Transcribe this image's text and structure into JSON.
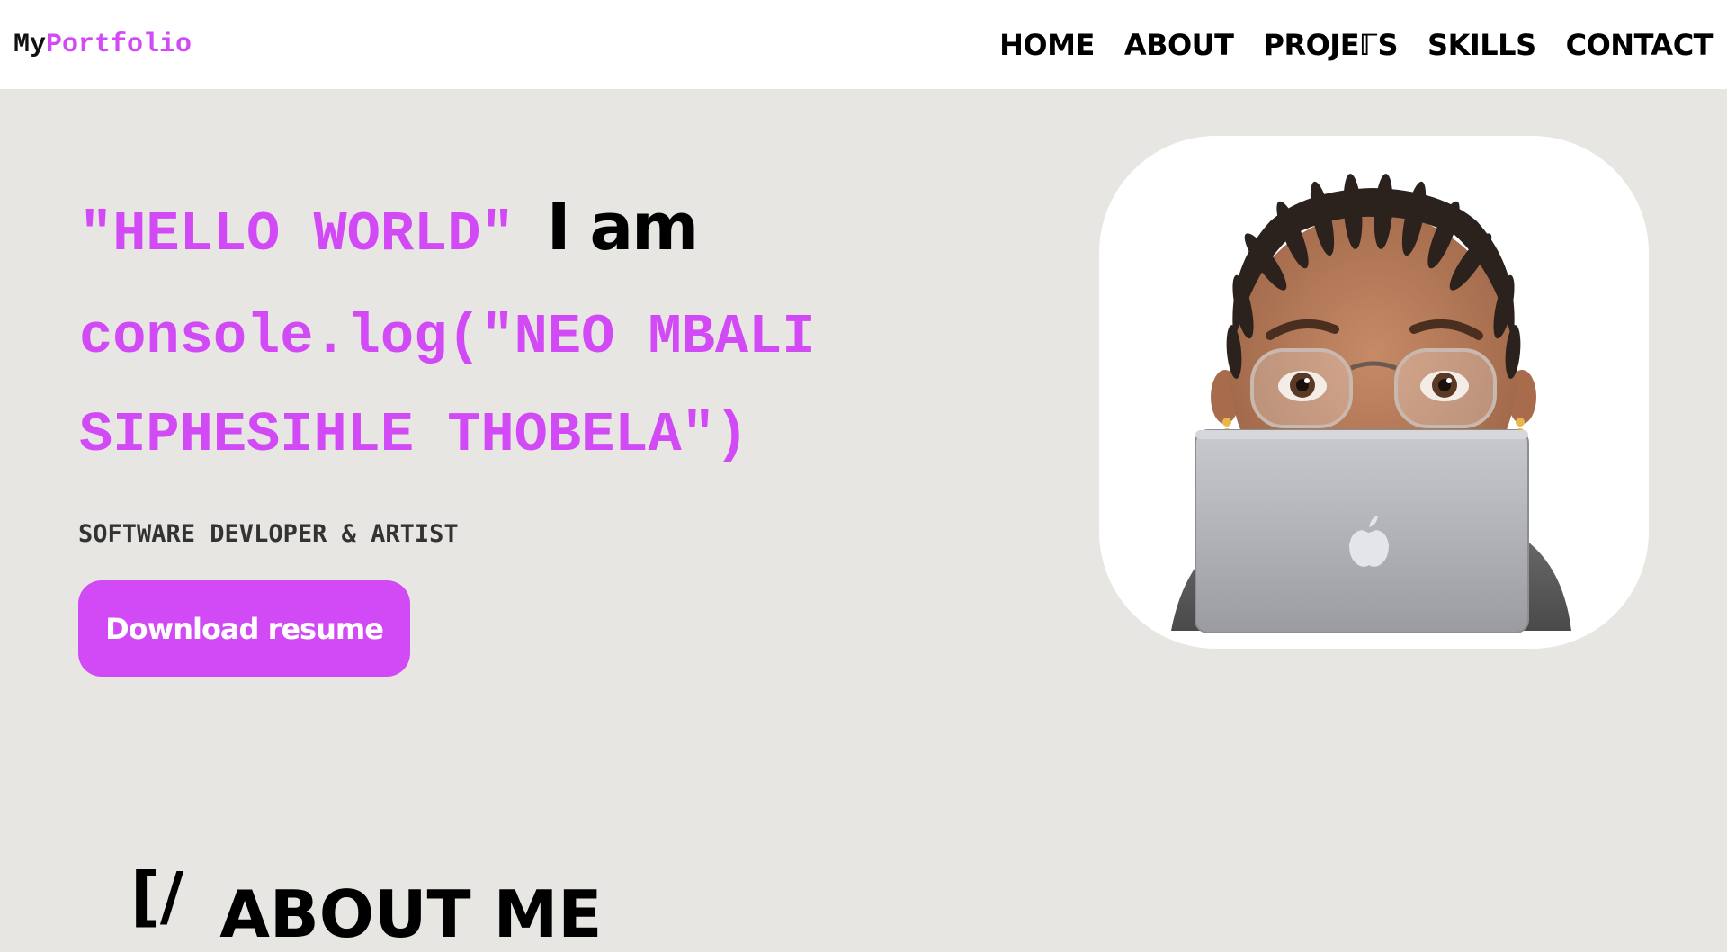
{
  "nav": {
    "logo_part1": "My",
    "logo_part2": "Portfolio",
    "links": [
      {
        "label": "HOME"
      },
      {
        "label": "ABOUT"
      },
      {
        "label": "PROJEℾS"
      },
      {
        "label": "SKILLS"
      },
      {
        "label": "CONTACT"
      }
    ]
  },
  "hero": {
    "hello": "\"HELLO WORLD\"",
    "iam": "I am",
    "code_line1": "console.log(\"NEO MBALI",
    "code_line2": "SIPHESIHLE THOBELA\")",
    "subtitle": "SOFTWARE DEVLOPER & ARTIST",
    "button_label": "Download resume"
  },
  "about": {
    "bracket": "[/",
    "title": "ABOUT ME"
  },
  "colors": {
    "accent": "#d14af5",
    "background": "#e7e6e3",
    "navbar": "#ffffff"
  }
}
